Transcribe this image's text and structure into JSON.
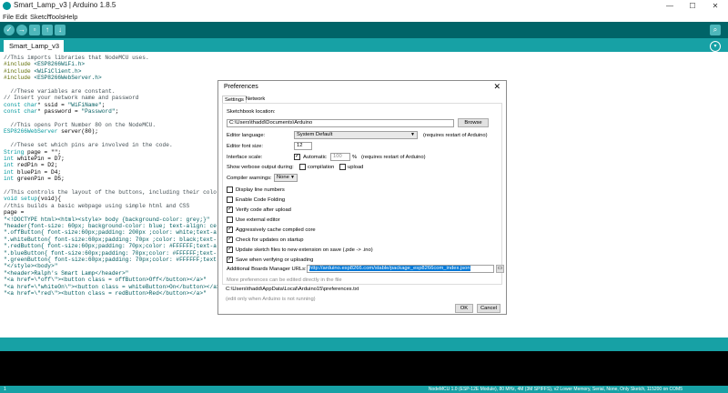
{
  "window": {
    "title": "Smart_Lamp_v3 | Arduino 1.8.5",
    "min": "—",
    "max": "☐",
    "close": "✕"
  },
  "menu": [
    "File",
    "Edit",
    "Sketch",
    "Tools",
    "Help"
  ],
  "tab": {
    "label": "Smart_Lamp_v3"
  },
  "code": [
    [
      [
        "c-com",
        "//This imports libraries that NodeMCU uses."
      ]
    ],
    [
      [
        "c-pre",
        "#include "
      ],
      [
        "c-str",
        "<ESP8266WiFi.h>"
      ]
    ],
    [
      [
        "c-pre",
        "#include "
      ],
      [
        "c-str",
        "<WiFiClient.h>"
      ]
    ],
    [
      [
        "c-pre",
        "#include "
      ],
      [
        "c-str",
        "<ESP8266WebServer.h>"
      ]
    ],
    [],
    [
      [
        "c-com",
        "  //These variables are constant."
      ]
    ],
    [
      [
        "c-com",
        "// Insert your network name and password"
      ]
    ],
    [
      [
        "c-kw",
        "const char"
      ],
      [
        "c-txt",
        "* ssid = "
      ],
      [
        "c-str",
        "\"WiFiName\""
      ],
      [
        "c-txt",
        ";"
      ]
    ],
    [
      [
        "c-kw",
        "const char"
      ],
      [
        "c-txt",
        "* password = "
      ],
      [
        "c-str",
        "\"Password\""
      ],
      [
        "c-txt",
        ";"
      ]
    ],
    [],
    [
      [
        "c-com",
        "  //This opens Port Number 80 on the NodeMCU."
      ]
    ],
    [
      [
        "c-kw",
        "ESP8266WebServer"
      ],
      [
        "c-txt",
        " server(80);"
      ]
    ],
    [],
    [
      [
        "c-com",
        "  //These set which pins are involved in the code."
      ]
    ],
    [
      [
        "c-kw",
        "String"
      ],
      [
        "c-txt",
        " page = \"\";"
      ]
    ],
    [
      [
        "c-kw",
        "int"
      ],
      [
        "c-txt",
        " whitePin = D7;"
      ]
    ],
    [
      [
        "c-kw",
        "int"
      ],
      [
        "c-txt",
        " redPin = D2;"
      ]
    ],
    [
      [
        "c-kw",
        "int"
      ],
      [
        "c-txt",
        " bluePin = D4;"
      ]
    ],
    [
      [
        "c-kw",
        "int"
      ],
      [
        "c-txt",
        " greenPin = D5;"
      ]
    ],
    [],
    [
      [
        "c-com",
        "//This controls the layout of the buttons, including their colo"
      ]
    ],
    [
      [
        "c-kw",
        "void"
      ],
      [
        "c-txt",
        " "
      ],
      [
        "c-kw",
        "setup"
      ],
      [
        "c-txt",
        "(void){"
      ]
    ],
    [
      [
        "c-com",
        "//this builds a basic webpage using simple html and CSS"
      ]
    ],
    [
      [
        "c-txt",
        "page = "
      ]
    ],
    [
      [
        "c-str",
        "\"<!DOCTYPE html><html><style> body {background-color: grey;}\""
      ]
    ],
    [
      [
        "c-str",
        "\"header{font-size: 60px; background-color: blue; text-align: ce"
      ]
    ],
    [
      [
        "c-str",
        "\".offButton{ font-size:60px;padding: 200px ;color: white;text-a"
      ]
    ],
    [
      [
        "c-str",
        "\".whiteButton{ font-size:60px;padding: 70px ;color: black;text-"
      ]
    ],
    [
      [
        "c-str",
        "\".redButton{ font-size:60px;padding: 70px;color: #FFFFFF;text-a"
      ]
    ],
    [
      [
        "c-str",
        "\".blueButton{ font-size:60px;padding: 70px;color: #FFFFFF;text-"
      ]
    ],
    [
      [
        "c-str",
        "\".greenButton{ font-size:60px;padding: 70px;color: #FFFFFF;text"
      ]
    ],
    [
      [
        "c-str",
        "\"</style><body>\""
      ]
    ],
    [
      [
        "c-str",
        "\"<header>Ralph's Smart Lamp</header>\""
      ]
    ],
    [
      [
        "c-str",
        "\"<a href=\\\"off\\\"><button class = offButton>Off</button></a>\""
      ]
    ],
    [
      [
        "c-str",
        "\"<a href=\\\"whiteOn\\\"><button class = whiteButton>On</button></a>\""
      ]
    ],
    [
      [
        "c-str",
        "\"<a href=\\\"red\\\"><button class = redButton>Red</button></a>\""
      ]
    ]
  ],
  "status_bar": {
    "line_number": "1",
    "board": "NodeMCU 1.0 (ESP-12E Module), 80 MHz, 4M (3M SPIFFS), v2 Lower Memory, Serial, None, Only Sketch, 115200 on COM5"
  },
  "prefs": {
    "title": "Preferences",
    "tabs": [
      "Settings",
      "Network"
    ],
    "sketchbook_label": "Sketchbook location:",
    "sketchbook_path": "C:\\Users\\thadd\\Documents\\Arduino",
    "browse": "Browse",
    "editor_language_label": "Editor language:",
    "editor_language": "System Default",
    "restart_note": "(requires restart of Arduino)",
    "font_size_label": "Editor font size:",
    "font_size": "12",
    "scale_label": "Interface scale:",
    "automatic": "Automatic",
    "scale_value": "100",
    "scale_unit": "%",
    "scale_note": "(requires restart of Arduino)",
    "verbose_label": "Show verbose output during:",
    "compilation": "compilation",
    "upload": "upload",
    "warnings_label": "Compiler warnings:",
    "warnings": "None",
    "options": [
      {
        "label": "Display line numbers",
        "checked": false
      },
      {
        "label": "Enable Code Folding",
        "checked": false
      },
      {
        "label": "Verify code after upload",
        "checked": true
      },
      {
        "label": "Use external editor",
        "checked": false
      },
      {
        "label": "Aggressively cache compiled core",
        "checked": true
      },
      {
        "label": "Check for updates on startup",
        "checked": true
      },
      {
        "label": "Update sketch files to new extension on save (.pde -> .ino)",
        "checked": true
      },
      {
        "label": "Save when verifying or uploading",
        "checked": true
      }
    ],
    "boards_url_label": "Additional Boards Manager URLs:",
    "boards_url": "http://arduino.esp8266.com/stable/package_esp8266com_index.json",
    "more_note": "More preferences can be edited directly in the file",
    "prefs_path": "C:\\Users\\thadd\\AppData\\Local\\Arduino15\\preferences.txt",
    "edit_note": "(edit only when Arduino is not running)",
    "ok": "OK",
    "cancel": "Cancel"
  }
}
